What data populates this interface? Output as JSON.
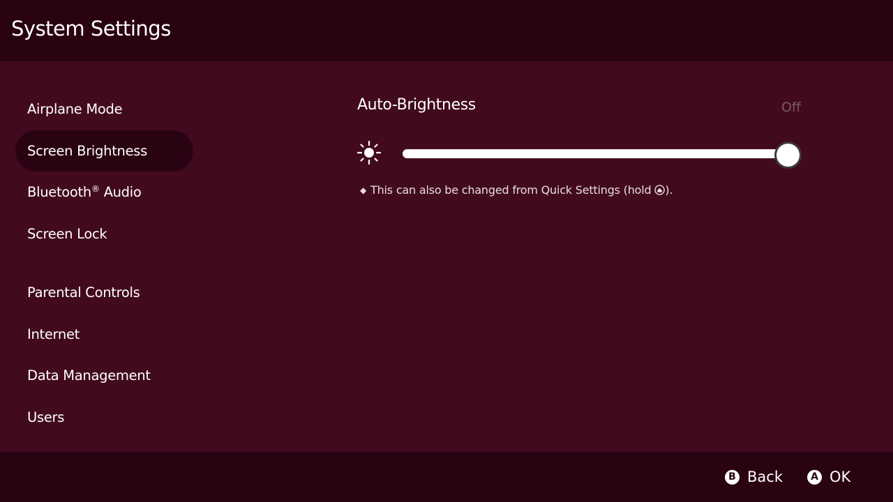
{
  "header": {
    "title": "System Settings"
  },
  "sidebar": {
    "items": [
      {
        "label": "Airplane Mode"
      },
      {
        "label": "Screen Brightness",
        "selected": true
      },
      {
        "label": "Bluetooth",
        "sup": "®",
        "suffix": " Audio"
      },
      {
        "label": "Screen Lock"
      },
      {
        "label": "Parental Controls"
      },
      {
        "label": "Internet"
      },
      {
        "label": "Data Management"
      },
      {
        "label": "Users"
      }
    ]
  },
  "main": {
    "auto_brightness": {
      "label": "Auto-Brightness",
      "value": "Off"
    },
    "brightness_slider": {
      "icon": "sun-icon",
      "value_percent": 100
    },
    "note": {
      "bullet": "◆",
      "text": "This can also be changed from Quick Settings (hold ",
      "icon": "home-button-icon",
      "end": ")."
    }
  },
  "footer": {
    "back": {
      "glyph": "B",
      "label": "Back"
    },
    "ok": {
      "glyph": "A",
      "label": "OK"
    }
  },
  "colors": {
    "background": "#420a1f",
    "bars": "#2a0313",
    "selected": "#2a0313",
    "off_text": "#7a5a66"
  }
}
